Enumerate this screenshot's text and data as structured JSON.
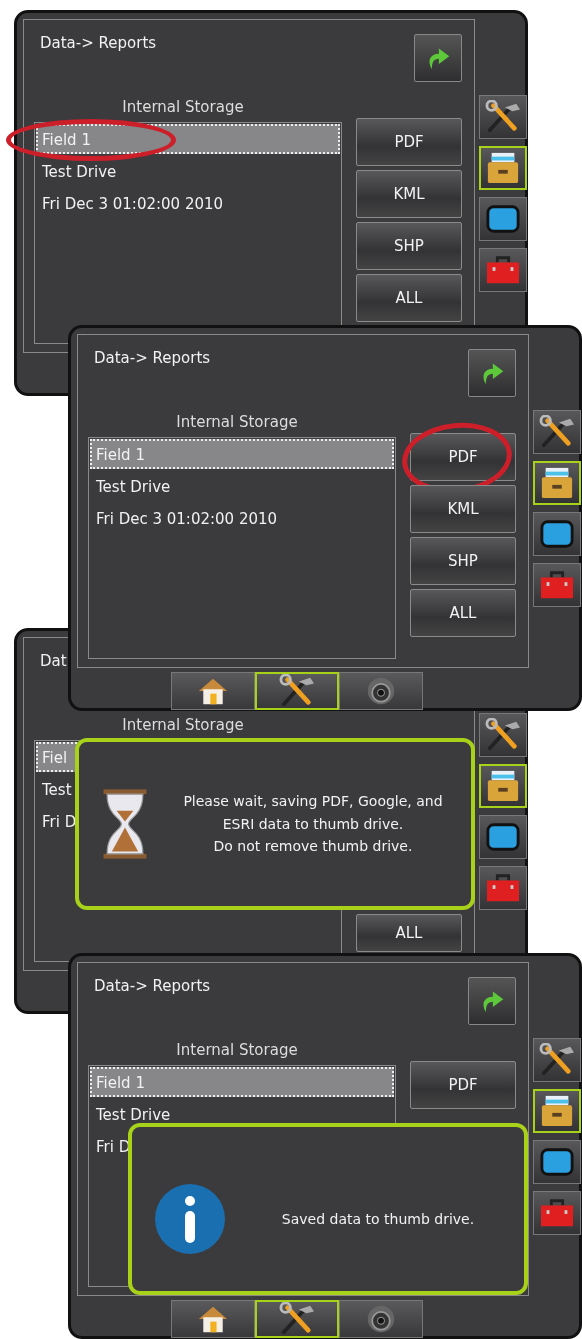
{
  "panels": [
    {
      "title": "Data-> Reports",
      "back": true,
      "storage_label": "Internal Storage",
      "list": [
        {
          "text": "Field 1",
          "selected": true,
          "circled": true
        },
        {
          "text": "Test Drive",
          "selected": false,
          "circled": false
        },
        {
          "text": "Fri Dec 3 01:02:00 2010",
          "selected": false,
          "circled": false
        }
      ],
      "buttons": [
        {
          "label": "PDF",
          "circled": false
        },
        {
          "label": "KML",
          "circled": false
        },
        {
          "label": "SHP",
          "circled": false
        },
        {
          "label": "ALL",
          "circled": false
        }
      ],
      "side_tabs": [
        {
          "kind": "tools",
          "selected": false
        },
        {
          "kind": "drawer",
          "selected": true
        },
        {
          "kind": "screen",
          "selected": false
        },
        {
          "kind": "toolbox",
          "selected": false
        }
      ]
    },
    {
      "title": "Data-> Reports",
      "back": true,
      "storage_label": "Internal Storage",
      "list": [
        {
          "text": "Field 1",
          "selected": true,
          "circled": false
        },
        {
          "text": "Test Drive",
          "selected": false,
          "circled": false
        },
        {
          "text": "Fri Dec 3 01:02:00 2010",
          "selected": false,
          "circled": false
        }
      ],
      "buttons": [
        {
          "label": "PDF",
          "circled": true
        },
        {
          "label": "KML",
          "circled": false
        },
        {
          "label": "SHP",
          "circled": false
        },
        {
          "label": "ALL",
          "circled": false
        }
      ],
      "side_tabs": [
        {
          "kind": "tools",
          "selected": false
        },
        {
          "kind": "drawer",
          "selected": true
        },
        {
          "kind": "screen",
          "selected": false
        },
        {
          "kind": "toolbox",
          "selected": false
        }
      ],
      "nav": [
        {
          "kind": "home",
          "selected": false
        },
        {
          "kind": "tools",
          "selected": true
        },
        {
          "kind": "camera",
          "selected": false
        }
      ]
    },
    {
      "title": "Dat",
      "back": false,
      "storage_label": "Internal Storage",
      "list": [
        {
          "text": "Fiel",
          "selected": true,
          "circled": false
        },
        {
          "text": "Test",
          "selected": false,
          "circled": false
        },
        {
          "text": "Fri D",
          "selected": false,
          "circled": false
        }
      ],
      "buttons": [
        {
          "label": "ALL",
          "circled": false
        }
      ],
      "side_tabs": [
        {
          "kind": "tools",
          "selected": false
        },
        {
          "kind": "drawer",
          "selected": true
        },
        {
          "kind": "screen",
          "selected": false
        },
        {
          "kind": "toolbox",
          "selected": false
        }
      ],
      "dialog": {
        "kind": "wait",
        "message": "Please wait, saving PDF, Google, and ESRI data to thumb drive.\nDo not remove thumb drive."
      }
    },
    {
      "title": "Data-> Reports",
      "back": true,
      "storage_label": "Internal Storage",
      "list": [
        {
          "text": "Field 1",
          "selected": true,
          "circled": false
        },
        {
          "text": "Test Drive",
          "selected": false,
          "circled": false
        },
        {
          "text": "Fri D",
          "selected": false,
          "circled": false
        }
      ],
      "buttons": [
        {
          "label": "PDF",
          "circled": false
        }
      ],
      "side_tabs": [
        {
          "kind": "tools",
          "selected": false
        },
        {
          "kind": "drawer",
          "selected": true
        },
        {
          "kind": "screen",
          "selected": false
        },
        {
          "kind": "toolbox",
          "selected": false
        }
      ],
      "nav": [
        {
          "kind": "home",
          "selected": false
        },
        {
          "kind": "tools",
          "selected": true
        },
        {
          "kind": "camera",
          "selected": false
        }
      ],
      "dialog": {
        "kind": "info",
        "message": "Saved data to thumb drive."
      }
    }
  ]
}
